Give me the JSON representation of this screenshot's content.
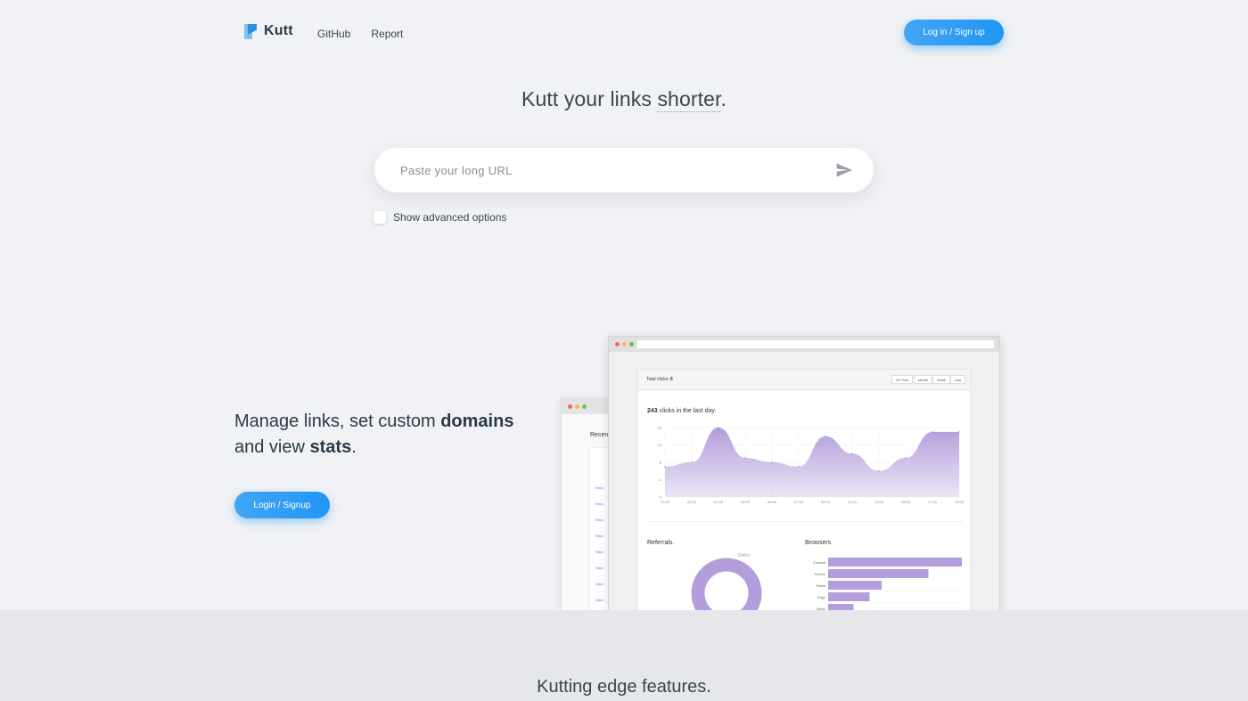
{
  "header": {
    "logo_text": "Kutt",
    "nav": [
      "GitHub",
      "Report"
    ],
    "login_label": "Log in / Sign up"
  },
  "hero": {
    "title_prefix": "Kutt your links ",
    "title_word": "shorter",
    "title_suffix": ".",
    "url_placeholder": "Paste your long URL",
    "advanced_label": "Show advanced options"
  },
  "feature": {
    "line1_prefix": "Manage links, set custom ",
    "line1_bold": "domains",
    "line2_prefix": "and view ",
    "line2_bold": "stats",
    "line2_suffix": ".",
    "button_label": "Login / Signup"
  },
  "stats_preview": {
    "total_clicks_label": "Total clicks: ",
    "total_clicks_value": "6",
    "periods": [
      "All Time",
      "Month",
      "Week",
      "Day"
    ],
    "clicks_value": "243",
    "clicks_text": " clicks in the last day.",
    "recent_label": "Recen",
    "link_rows": [
      "https",
      "https",
      "https",
      "https",
      "https",
      "https",
      "https",
      "https"
    ],
    "referrals_label": "Referrals.",
    "browsers_label": "Browsers.",
    "donut_label": "Direct"
  },
  "chart_data": [
    {
      "type": "area",
      "x": [
        "21:00",
        "22:00",
        "01:00",
        "03:00",
        "05:00",
        "07:00",
        "09:00",
        "11:00",
        "13:00",
        "15:00",
        "17:00",
        "19:00"
      ],
      "values": [
        7,
        8,
        16,
        9,
        8,
        7,
        14,
        10,
        6,
        9,
        15,
        15
      ],
      "ylim": [
        0,
        16
      ],
      "yticks": [
        0,
        4,
        8,
        12,
        16
      ],
      "grid": true,
      "color": "#b39ddb"
    },
    {
      "type": "bar",
      "orientation": "horizontal",
      "categories": [
        "Chrome",
        "Firefox",
        "Safari",
        "Edge",
        "Other"
      ],
      "values": [
        100,
        75,
        40,
        31,
        19
      ],
      "color": "#b39ddb"
    }
  ],
  "colors": {
    "accent": "#2196f3",
    "chart": "#b39ddb",
    "background": "#f1f2f5"
  },
  "features_title": "Kutting edge features."
}
